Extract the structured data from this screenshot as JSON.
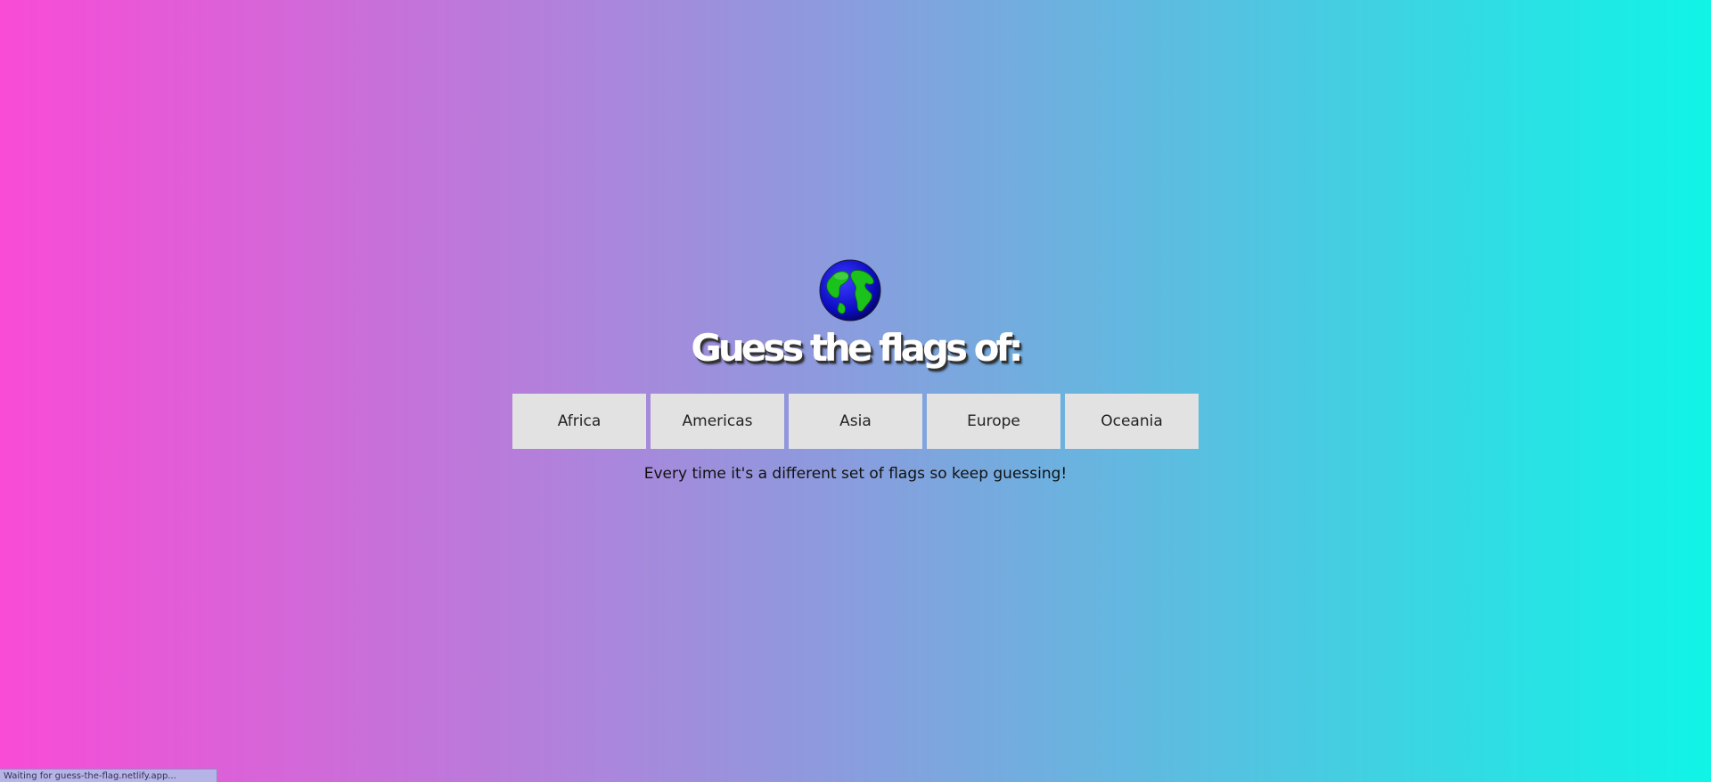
{
  "page": {
    "title": "Guess the flags of:",
    "tagline": "Every time it's a different set of flags so keep guessing!"
  },
  "regions": [
    {
      "label": "Africa"
    },
    {
      "label": "Americas"
    },
    {
      "label": "Asia"
    },
    {
      "label": "Europe"
    },
    {
      "label": "Oceania"
    }
  ],
  "status_bar": {
    "text": "Waiting for guess-the-flag.netlify.app..."
  },
  "icons": {
    "globe": "globe-icon"
  },
  "colors": {
    "gradient_left": "#f94bd6",
    "gradient_right": "#10f4e6",
    "button_bg": "#e2e2e2",
    "title_color": "#ffffff"
  }
}
